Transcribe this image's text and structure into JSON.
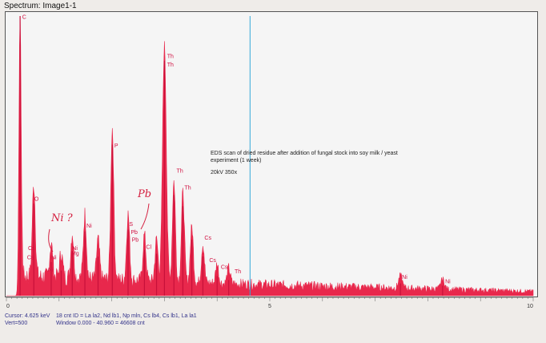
{
  "window": {
    "title": "Spectrum: Image1-1"
  },
  "annotation": {
    "line1": "EDS scan of dried residue after addition of fungal stock into soy milk / yeast",
    "line2": "experiment (1 week)",
    "line3": "20kV 350x"
  },
  "handwritten": {
    "ni": "Ni ?",
    "pb": "Pb"
  },
  "status": {
    "cursor": "Cursor: 4.625 keV",
    "vert": "Vert=500",
    "ids": "18 cnt ID = La la2, Nd lb1, Np mln, Cs lb4, Cs lb1, La la1",
    "window": "Window 0.000 - 40.960 =   46608 cnt"
  },
  "colors": {
    "spectrum": "#e8284c",
    "cursor": "#35a8d8",
    "label": "#d01040"
  },
  "chart_data": {
    "type": "area",
    "xlim": [
      0,
      10
    ],
    "ylim": [
      0,
      500
    ],
    "xticks": [
      "0",
      "5",
      "10"
    ],
    "cursor_kev": 4.625,
    "peaks": [
      {
        "x": 0.26,
        "y": 500,
        "w": 0.03
      },
      {
        "x": 0.52,
        "y": 165,
        "w": 0.04
      },
      {
        "x": 0.85,
        "y": 60,
        "w": 0.04
      },
      {
        "x": 1.04,
        "y": 45,
        "w": 0.04
      },
      {
        "x": 1.25,
        "y": 80,
        "w": 0.04
      },
      {
        "x": 1.49,
        "y": 115,
        "w": 0.04
      },
      {
        "x": 1.74,
        "y": 70,
        "w": 0.04
      },
      {
        "x": 2.01,
        "y": 270,
        "w": 0.04
      },
      {
        "x": 2.31,
        "y": 118,
        "w": 0.04
      },
      {
        "x": 2.62,
        "y": 82,
        "w": 0.04
      },
      {
        "x": 2.85,
        "y": 75,
        "w": 0.04
      },
      {
        "x": 3.0,
        "y": 420,
        "w": 0.05
      },
      {
        "x": 3.18,
        "y": 180,
        "w": 0.04
      },
      {
        "x": 3.35,
        "y": 160,
        "w": 0.04
      },
      {
        "x": 3.52,
        "y": 100,
        "w": 0.04
      },
      {
        "x": 3.73,
        "y": 70,
        "w": 0.04
      },
      {
        "x": 4.0,
        "y": 35,
        "w": 0.04
      },
      {
        "x": 4.22,
        "y": 28,
        "w": 0.04
      },
      {
        "x": 7.48,
        "y": 22,
        "w": 0.05
      },
      {
        "x": 8.28,
        "y": 18,
        "w": 0.05
      }
    ],
    "labels": [
      {
        "text": "C",
        "x": 0.27,
        "y": 495
      },
      {
        "text": "O",
        "x": 0.5,
        "y": 170
      },
      {
        "text": "Cs",
        "x": 0.38,
        "y": 82
      },
      {
        "text": "Cs",
        "x": 0.36,
        "y": 65
      },
      {
        "text": "Ni",
        "x": 0.82,
        "y": 65
      },
      {
        "text": "Ni",
        "x": 0.76,
        "y": 43
      },
      {
        "text": "Ni",
        "x": 1.22,
        "y": 82
      },
      {
        "text": "Mg",
        "x": 1.2,
        "y": 72
      },
      {
        "text": "Ni",
        "x": 1.49,
        "y": 122
      },
      {
        "text": "P",
        "x": 2.02,
        "y": 265
      },
      {
        "text": "S",
        "x": 2.3,
        "y": 125
      },
      {
        "text": "Pb",
        "x": 2.33,
        "y": 110
      },
      {
        "text": "Pb",
        "x": 2.35,
        "y": 97
      },
      {
        "text": "Cl",
        "x": 2.62,
        "y": 84
      },
      {
        "text": "Th",
        "x": 3.02,
        "y": 425
      },
      {
        "text": "Th",
        "x": 3.02,
        "y": 410
      },
      {
        "text": "Th",
        "x": 3.2,
        "y": 220
      },
      {
        "text": "Th",
        "x": 3.35,
        "y": 190
      },
      {
        "text": "Cs",
        "x": 3.73,
        "y": 100
      },
      {
        "text": "Cs",
        "x": 3.82,
        "y": 60
      },
      {
        "text": "Cs",
        "x": 4.04,
        "y": 48
      },
      {
        "text": "Th",
        "x": 4.3,
        "y": 40
      },
      {
        "text": "Ni",
        "x": 7.48,
        "y": 30
      },
      {
        "text": "Ni",
        "x": 8.3,
        "y": 22
      }
    ]
  }
}
